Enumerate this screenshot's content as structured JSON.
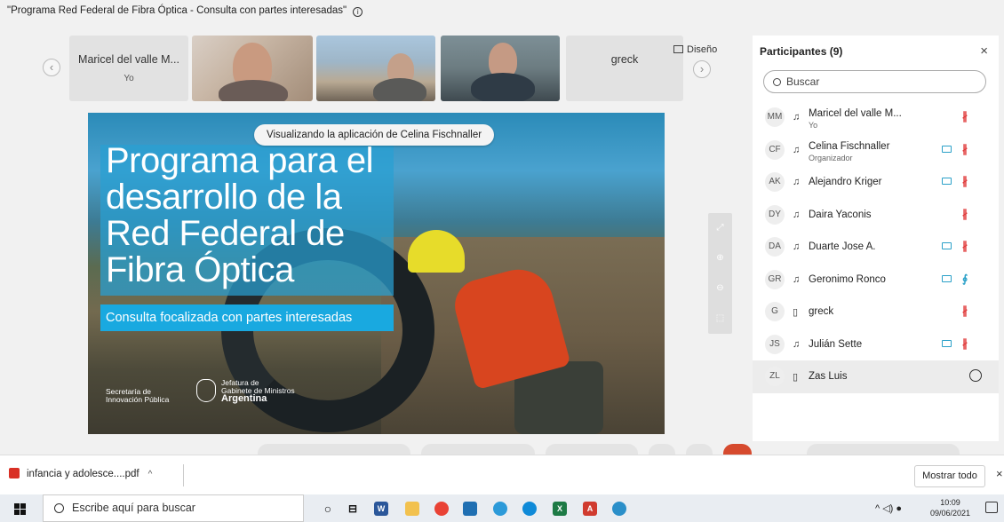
{
  "meeting": {
    "title": "\"Programa Red Federal de Fibra Óptica - Consulta con partes interesadas\"",
    "info_icon": "info-icon"
  },
  "gallery": {
    "tile_self_name": "Maricel del valle M...",
    "tile_self_sub": "Yo",
    "tile_greck_name": "greck",
    "prev_icon": "chevron-left-icon",
    "next_icon": "chevron-right-icon",
    "layout_label": "Diseño"
  },
  "stage": {
    "viewing_label": "Visualizando la aplicación de Celina Fischnaller",
    "slide_title": "Programa para el desarrollo de la Red Federal de Fibra Óptica",
    "slide_subtitle": "Consulta focalizada con partes interesadas",
    "logo_left_line1": "Secretaría de",
    "logo_left_line2": "Innovación Pública",
    "logo_right_line1": "Jefatura de",
    "logo_right_line2": "Gabinete de Ministros",
    "logo_right_line3": "Argentina"
  },
  "participants": {
    "title": "Participantes (9)",
    "close_icon": "close-icon",
    "search_placeholder": "Buscar",
    "items": [
      {
        "initials": "MM",
        "name": "Maricel del valle M...",
        "role": "Yo",
        "device": "headset",
        "camera": false,
        "mic": "muted"
      },
      {
        "initials": "CF",
        "name": "Celina Fischnaller",
        "role": "Organizador",
        "device": "headset",
        "camera": true,
        "mic": "muted"
      },
      {
        "initials": "AK",
        "name": "Alejandro Kriger",
        "role": "",
        "device": "headset",
        "camera": true,
        "mic": "muted"
      },
      {
        "initials": "DY",
        "name": "Daira Yaconis",
        "role": "",
        "device": "headset",
        "camera": false,
        "mic": "muted"
      },
      {
        "initials": "DA",
        "name": "Duarte Jose A.",
        "role": "",
        "device": "headset",
        "camera": true,
        "mic": "muted"
      },
      {
        "initials": "GR",
        "name": "Geronimo Ronco",
        "role": "",
        "device": "headset",
        "camera": true,
        "mic": "on"
      },
      {
        "initials": "G",
        "name": "greck",
        "role": "",
        "device": "phone",
        "camera": false,
        "mic": "muted"
      },
      {
        "initials": "JS",
        "name": "Julián Sette",
        "role": "",
        "device": "headset",
        "camera": true,
        "mic": "muted"
      },
      {
        "initials": "ZL",
        "name": "Zas Luis",
        "role": "",
        "device": "phone",
        "camera": false,
        "mic": "none"
      }
    ]
  },
  "downloads": {
    "file_name": "infancia y adolesce....pdf",
    "show_all_label": "Mostrar todo",
    "close_label": "×"
  },
  "taskbar": {
    "search_placeholder": "Escribe aquí para buscar",
    "tray_text": "^ 📶 ⁽ᵢ⁾",
    "time": "10:09",
    "date": "09/06/2021"
  },
  "colors": {
    "accent": "#19a9e0",
    "mic_muted": "#e03a3a",
    "camera": "#2aa0c8"
  }
}
